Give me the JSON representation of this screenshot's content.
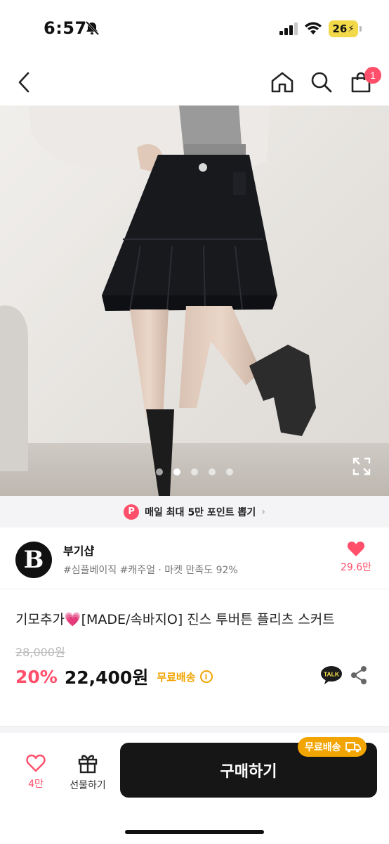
{
  "status_bar": {
    "time": "6:57",
    "battery": "26"
  },
  "nav": {
    "cart_badge": "1"
  },
  "gallery": {
    "dots": 5,
    "active_index": 1
  },
  "point_banner": {
    "badge": "P",
    "text": "매일 최대 5만 포인트 뽑기",
    "arrow": "›"
  },
  "shop": {
    "logo_letter": "B",
    "name": "부기샵",
    "tags": "#심플베이직 #캐주얼 · 마켓 만족도 92%",
    "likes": "29.6만"
  },
  "product": {
    "title_prefix": "기모추가",
    "title_emoji": "💗",
    "title_suffix": "[MADE/속바지O] 진스 투버튼 플리츠 스커트",
    "original_price": "28,000원",
    "discount": "20%",
    "price": "22,400원",
    "shipping": "무료배송",
    "info_symbol": "i",
    "talk_label": "TALK"
  },
  "bottom_bar": {
    "like_count": "4만",
    "gift_label": "선물하기",
    "buy_label": "구매하기",
    "ship_pill": "무료배송"
  },
  "colors": {
    "accent": "#ff4f6a",
    "shipping": "#f0a400",
    "buy_button": "#161616"
  }
}
